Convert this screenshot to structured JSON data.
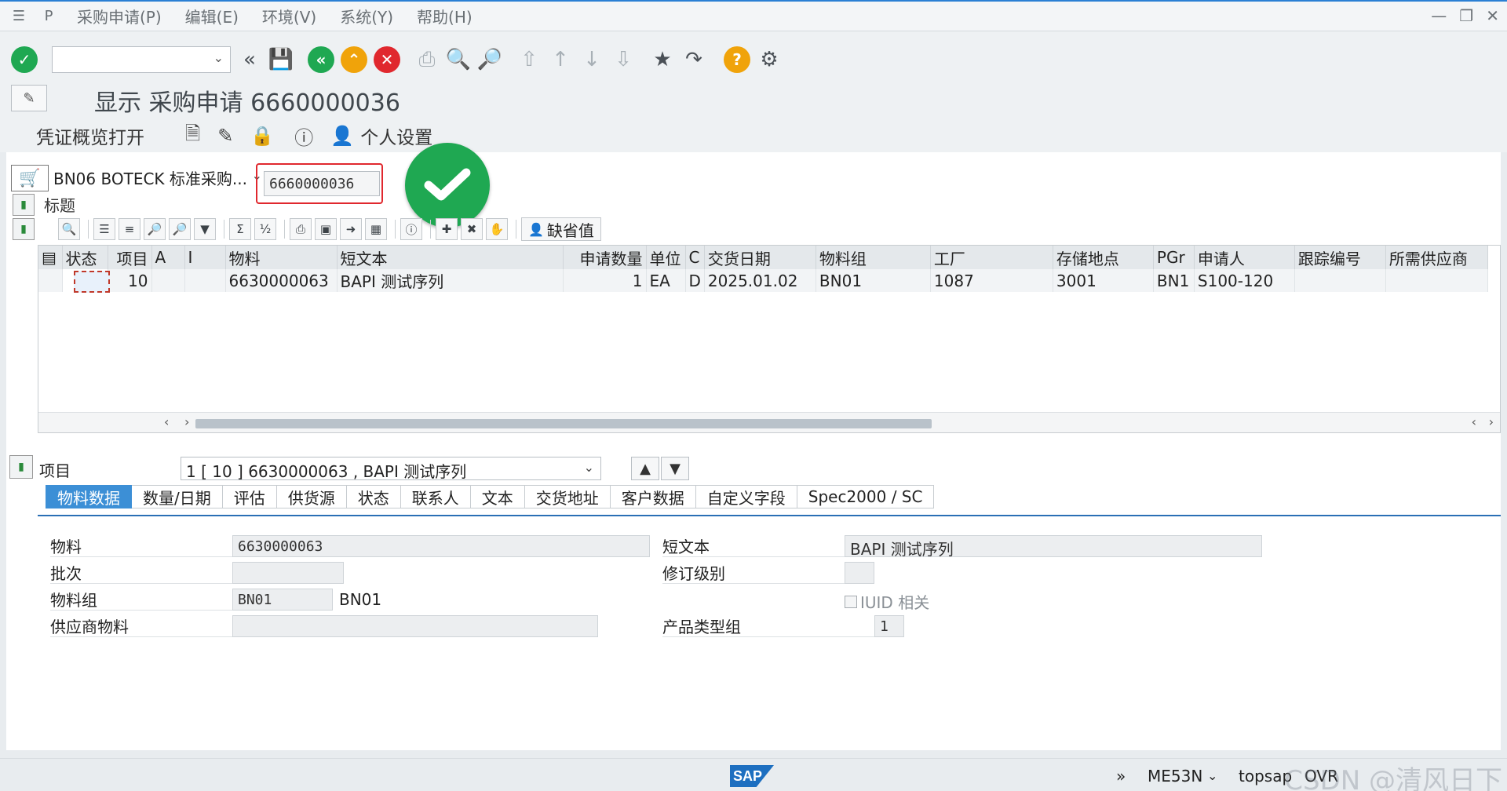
{
  "menu": {
    "items": [
      "采购申请(P)",
      "编辑(E)",
      "环境(V)",
      "系统(Y)",
      "帮助(H)"
    ]
  },
  "toolbar": {
    "command_value": ""
  },
  "page": {
    "title": "显示 采购申请 6660000036"
  },
  "subbar": {
    "overview_label": "凭证概览打开",
    "personal_settings_label": "个人设置"
  },
  "header": {
    "doc_type": "BN06 BOTECK 标准采购...",
    "doc_number": "6660000036",
    "section_label": "标题"
  },
  "grid_toolbar": {
    "defaults_label": "缺省值"
  },
  "grid": {
    "columns": [
      "状态",
      "项目",
      "A",
      "I",
      "物料",
      "短文本",
      "申请数量",
      "单位",
      "C",
      "交货日期",
      "物料组",
      "工厂",
      "存储地点",
      "PGr",
      "申请人",
      "跟踪编号",
      "所需供应商"
    ],
    "rows": [
      {
        "status": "",
        "item": "10",
        "a": "",
        "i": "",
        "material": "6630000063",
        "short_text": "BAPI 测试序列",
        "qty": "1",
        "unit": "EA",
        "c": "D",
        "delivery_date": "2025.01.02",
        "mat_group": "BN01",
        "plant": "1087",
        "storage": "3001",
        "pgr": "BN1",
        "requisitioner": "S100-120",
        "tracking": "",
        "vendor": ""
      }
    ]
  },
  "item_detail": {
    "label": "项目",
    "selected_item": "1 [ 10 ] 6630000063 , BAPI 测试序列",
    "tabs": [
      "物料数据",
      "数量/日期",
      "评估",
      "供货源",
      "状态",
      "联系人",
      "文本",
      "交货地址",
      "客户数据",
      "自定义字段",
      "Spec2000 / SC"
    ],
    "active_tab": "物料数据",
    "fields": {
      "material_label": "物料",
      "material_value": "6630000063",
      "batch_label": "批次",
      "batch_value": "",
      "mat_group_label": "物料组",
      "mat_group_value": "BN01",
      "mat_group_desc": "BN01",
      "vendor_mat_label": "供应商物料",
      "vendor_mat_value": "",
      "short_text_label": "短文本",
      "short_text_value": "BAPI 测试序列",
      "revision_label": "修订级别",
      "revision_value": "",
      "iuid_label": "IUID 相关",
      "prod_type_label": "产品类型组",
      "prod_type_value": "1"
    }
  },
  "status_bar": {
    "transaction": "ME53N",
    "system": "topsap",
    "mode": "OVR",
    "watermark": "CSDN @清风日下"
  }
}
